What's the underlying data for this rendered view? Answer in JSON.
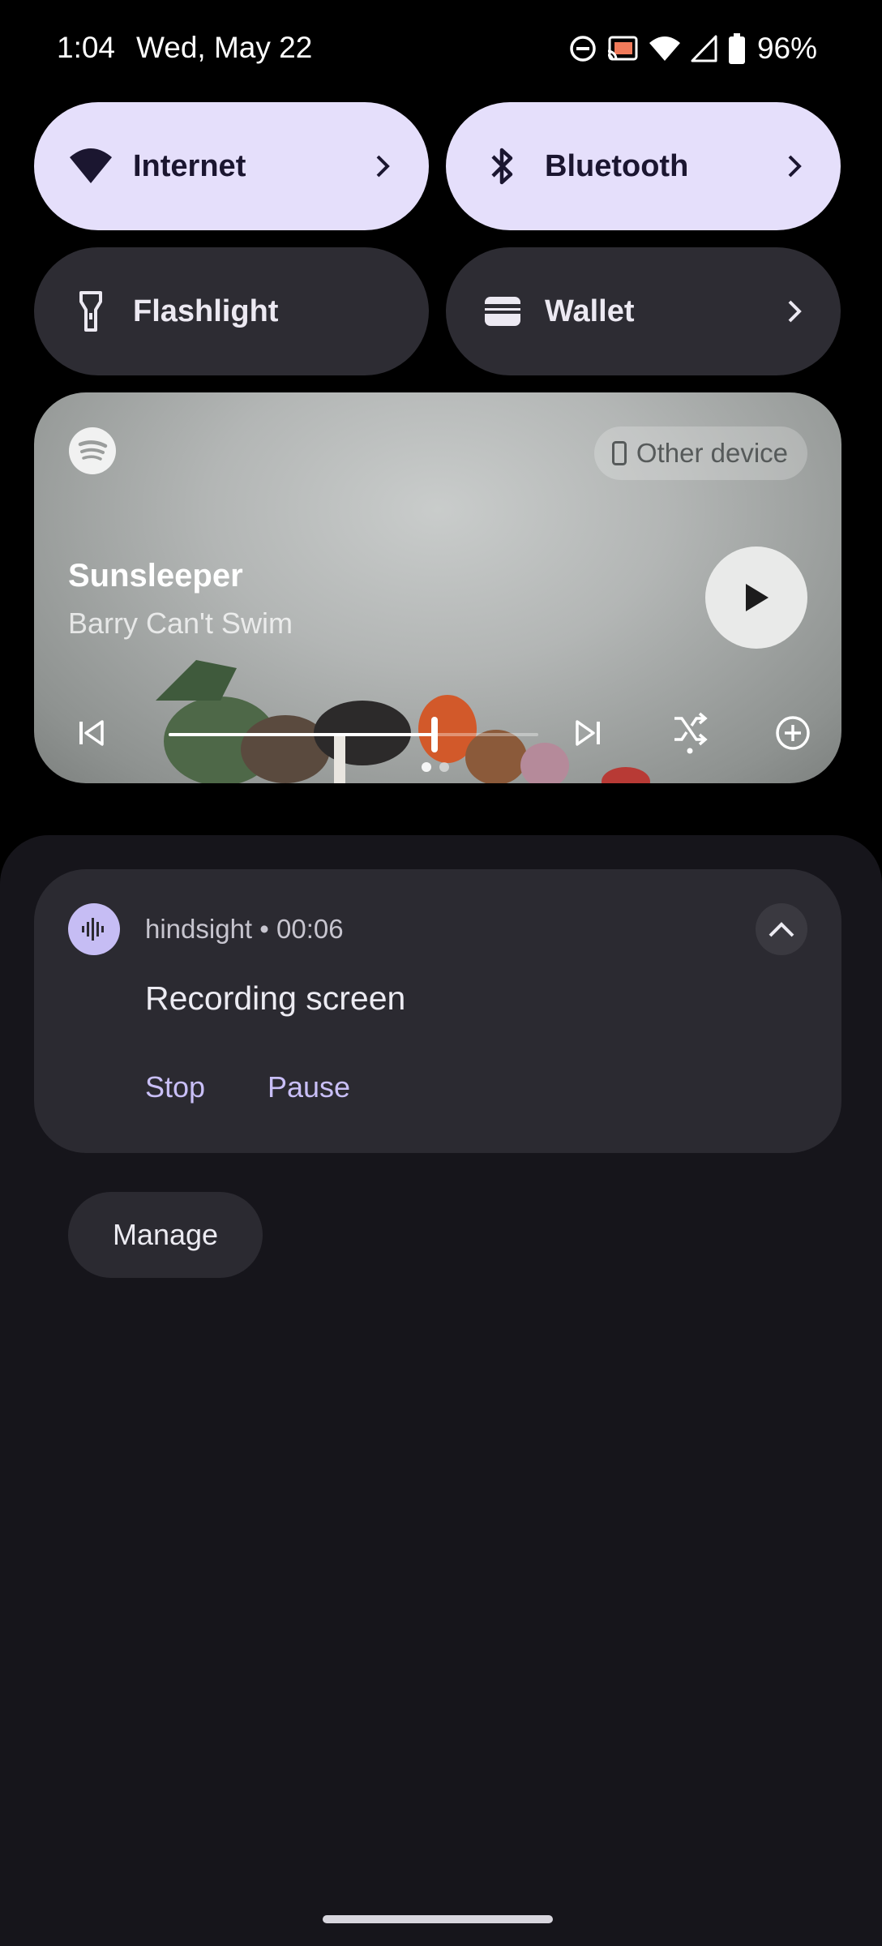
{
  "status_bar": {
    "time": "1:04",
    "date": "Wed, May 22",
    "battery": "96%",
    "icons": [
      "do-not-disturb-icon",
      "cast-icon",
      "wifi-icon",
      "cell-signal-icon",
      "battery-icon"
    ]
  },
  "tiles": [
    {
      "label": "Internet",
      "icon": "wifi-icon",
      "active": true,
      "chevron": true
    },
    {
      "label": "Bluetooth",
      "icon": "bluetooth-icon",
      "active": true,
      "chevron": true
    },
    {
      "label": "Flashlight",
      "icon": "flashlight-icon",
      "active": false,
      "chevron": false
    },
    {
      "label": "Wallet",
      "icon": "wallet-icon",
      "active": false,
      "chevron": true
    }
  ],
  "media": {
    "app": "spotify",
    "output": "Other device",
    "title": "Sunsleeper",
    "artist": "Barry Can't Swim",
    "progress": 0.72
  },
  "notification": {
    "app": "hindsight",
    "time": "00:06",
    "header": "hindsight • 00:06",
    "title": "Recording screen",
    "actions": [
      "Stop",
      "Pause"
    ]
  },
  "manage_label": "Manage",
  "colors": {
    "tile_active": "#e5dffb",
    "tile_inactive": "#2d2c33",
    "accent": "#c9bff7",
    "shade": "#16151b"
  }
}
